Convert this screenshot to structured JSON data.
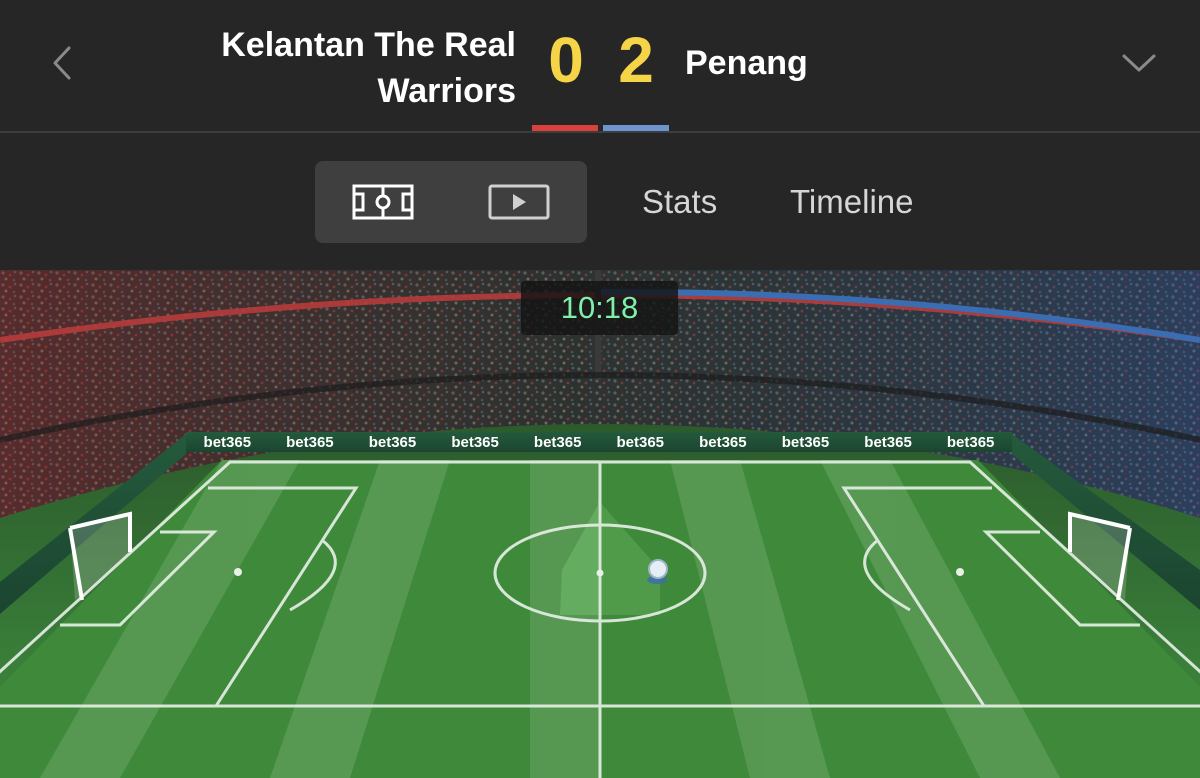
{
  "header": {
    "home_team": "Kelantan The Real Warriors",
    "away_team": "Penang",
    "home_score": "0",
    "away_score": "2",
    "home_color": "#d9413b",
    "away_color": "#6e93d0",
    "back_icon": "chevron-left-icon",
    "dropdown_icon": "chevron-down-icon"
  },
  "tabs": {
    "pitch_view_icon": "pitch-icon",
    "video_view_icon": "play-icon",
    "stats_label": "Stats",
    "timeline_label": "Timeline"
  },
  "match": {
    "clock": "10:18"
  },
  "pitch": {
    "board_text": "bet365",
    "pitch_color": "#3c8a3c"
  }
}
